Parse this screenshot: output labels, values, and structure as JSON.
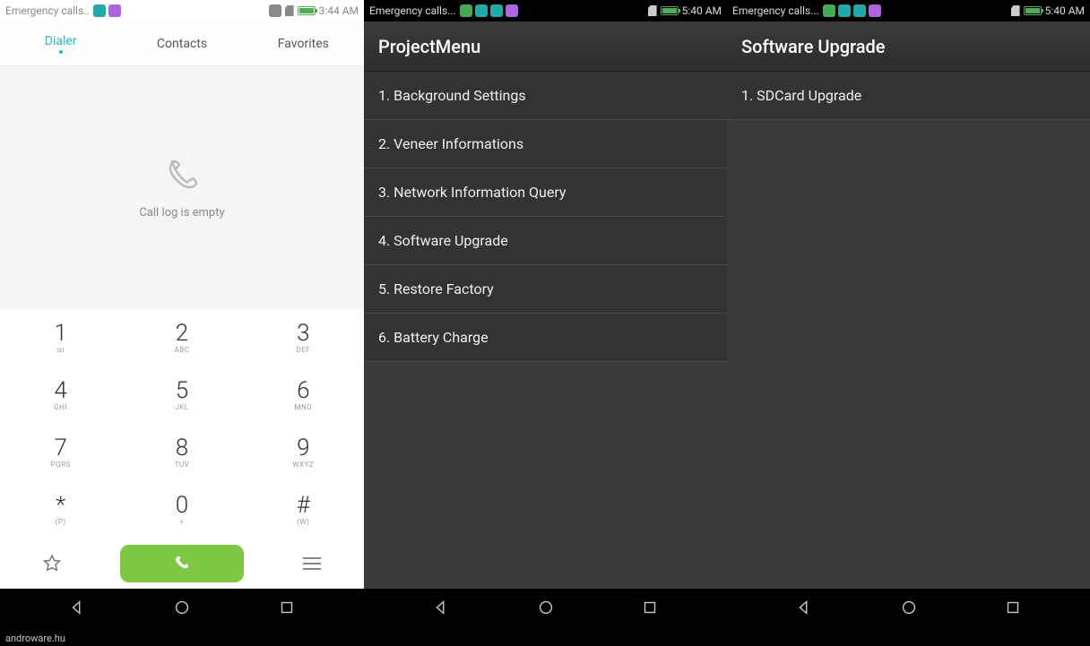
{
  "footer": "androware.hu",
  "screen1": {
    "statusbar": {
      "carrier": "Emergency calls..",
      "time": "3:44 AM"
    },
    "tabs": [
      {
        "label": "Dialer",
        "active": true
      },
      {
        "label": "Contacts",
        "active": false
      },
      {
        "label": "Favorites",
        "active": false
      }
    ],
    "calllog_empty": "Call log is empty",
    "keypad": [
      [
        {
          "num": "1",
          "sub": "∞"
        },
        {
          "num": "2",
          "sub": "ABC"
        },
        {
          "num": "3",
          "sub": "DEF"
        }
      ],
      [
        {
          "num": "4",
          "sub": "GHI"
        },
        {
          "num": "5",
          "sub": "JKL"
        },
        {
          "num": "6",
          "sub": "MNO"
        }
      ],
      [
        {
          "num": "7",
          "sub": "PQRS"
        },
        {
          "num": "8",
          "sub": "TUV"
        },
        {
          "num": "9",
          "sub": "WXYZ"
        }
      ],
      [
        {
          "num": "*",
          "sub": "(P)"
        },
        {
          "num": "0",
          "sub": "+"
        },
        {
          "num": "#",
          "sub": "(W)"
        }
      ]
    ]
  },
  "screen2": {
    "statusbar": {
      "carrier": "Emergency calls...",
      "time": "5:40 AM"
    },
    "title": "ProjectMenu",
    "items": [
      "1. Background Settings",
      "2. Veneer Informations",
      "3. Network Information Query",
      "4. Software Upgrade",
      "5. Restore Factory",
      "6. Battery Charge"
    ]
  },
  "screen3": {
    "statusbar": {
      "carrier": "Emergency calls...",
      "time": "5:40 AM"
    },
    "title": "Software Upgrade",
    "items": [
      "1. SDCard Upgrade"
    ]
  }
}
